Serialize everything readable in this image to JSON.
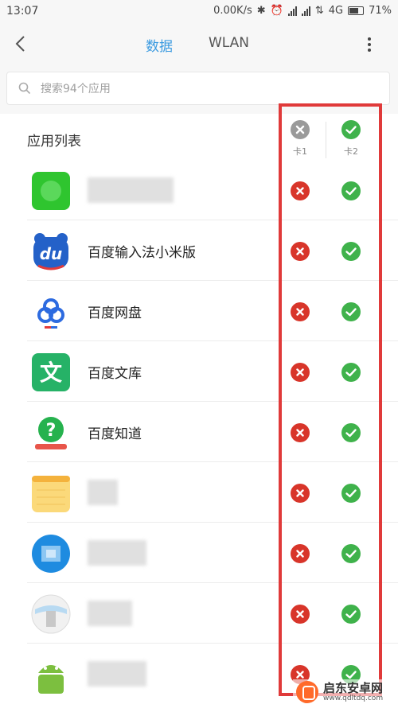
{
  "status_bar": {
    "time": "13:07",
    "speed": "0.00K/s",
    "network": "4G",
    "battery": "71%"
  },
  "header": {
    "tabs": [
      {
        "label": "数据",
        "active": true
      },
      {
        "label": "WLAN",
        "active": false
      }
    ],
    "icons": {
      "back": "chevron-left-icon",
      "more": "more-vertical-icon"
    }
  },
  "search": {
    "placeholder": "搜索94个应用"
  },
  "list": {
    "title": "应用列表",
    "columns": [
      {
        "label": "卡1",
        "state": "off"
      },
      {
        "label": "卡2",
        "state": "on"
      }
    ],
    "apps": [
      {
        "name": "",
        "icon": "green-app-icon",
        "card1": "off",
        "card2": "on"
      },
      {
        "name": "百度输入法小米版",
        "icon": "baidu-input-icon",
        "card1": "off",
        "card2": "on"
      },
      {
        "name": "百度网盘",
        "icon": "baidu-netdisk-icon",
        "card1": "off",
        "card2": "on"
      },
      {
        "name": "百度文库",
        "icon": "baidu-wenku-icon",
        "card1": "off",
        "card2": "on"
      },
      {
        "name": "百度知道",
        "icon": "baidu-zhidao-icon",
        "card1": "off",
        "card2": "on"
      },
      {
        "name": "",
        "icon": "notes-app-icon",
        "card1": "off",
        "card2": "on"
      },
      {
        "name": "",
        "icon": "blue-app-icon",
        "card1": "off",
        "card2": "on"
      },
      {
        "name": "",
        "icon": "white-app-icon",
        "card1": "off",
        "card2": "on"
      },
      {
        "name": "",
        "icon": "android-app-icon",
        "card1": "off",
        "card2": "on"
      }
    ]
  },
  "colors": {
    "accent": "#3a9ae0",
    "deny": "#d8352a",
    "allow": "#3fb24b",
    "annotation": "#e03a3a"
  },
  "watermark": {
    "title": "启东安卓网",
    "url": "www.qdltdq.com"
  }
}
